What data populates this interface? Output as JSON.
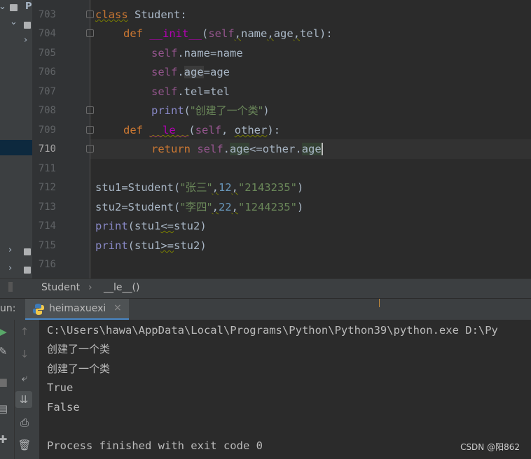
{
  "project_panel": {
    "root_label": "P"
  },
  "editor": {
    "lines": [
      {
        "num": "703"
      },
      {
        "num": "704"
      },
      {
        "num": "705"
      },
      {
        "num": "706"
      },
      {
        "num": "707"
      },
      {
        "num": "708"
      },
      {
        "num": "709"
      },
      {
        "num": "710"
      },
      {
        "num": "711"
      },
      {
        "num": "712"
      },
      {
        "num": "713"
      },
      {
        "num": "714"
      },
      {
        "num": "715"
      },
      {
        "num": "716"
      }
    ],
    "tokens": {
      "class_kw": "class",
      "class_name": " Student:",
      "def1": "def",
      "init": "__init__",
      "paren_open": "(",
      "self1": "self",
      "params1": "name",
      "c1": ",",
      "p_age": "age",
      "c2": ",",
      "p_tel": "tel",
      "close1": "):",
      "self_name": "self",
      "name_assign": ".name=name",
      "self_age": "self",
      "dot_age": ".",
      "age_attr": "age",
      "age_assign": "=age",
      "self_tel": "self",
      "tel_assign": ".tel=tel",
      "print1": "print",
      "print1_open": "(",
      "print1_str": "\"创建了一个类\"",
      "print1_close": ")",
      "def2": "def",
      "le": "__le__",
      "le_open": "(",
      "self2": "self",
      "other_sep": ", ",
      "other": "other",
      "le_close": "):",
      "ret": "return",
      "ret_self": "self",
      "ret_dot": ".",
      "ret_age": "age",
      "ret_op": "<=",
      "ret_other": "other.",
      "ret_age2": "age",
      "stu1_lhs": "stu1=Student(",
      "stu1_s1": "\"张三\"",
      "stu1_c1": ",",
      "stu1_n": "12",
      "stu1_c2": ",",
      "stu1_s2": "\"2143235\"",
      "stu1_close": ")",
      "stu2_lhs": "stu2=Student(",
      "stu2_s1": "\"李四\"",
      "stu2_c1": ",",
      "stu2_n": "22",
      "stu2_c2": ",",
      "stu2_s2": "\"1244235\"",
      "stu2_close": ")",
      "p3": "print",
      "p3_args_a": "(stu1",
      "p3_op": "<=",
      "p3_args_b": "stu2)",
      "p4": "print",
      "p4_args_a": "(stu1",
      "p4_op": ">=",
      "p4_args_b": "stu2)"
    }
  },
  "breadcrumb": {
    "class": "Student",
    "method": "__le__()"
  },
  "run_panel": {
    "label": "un:",
    "tab": "heimaxuexi",
    "close": "×",
    "output": [
      "C:\\Users\\hawa\\AppData\\Local\\Programs\\Python\\Python39\\python.exe D:\\Py",
      "创建了一个类",
      "创建了一个类",
      "True",
      "False",
      "",
      "Process finished with exit code 0"
    ]
  },
  "watermark": "CSDN @阳862",
  "colors": {
    "keyword": "#cc7832",
    "self": "#94558d",
    "string": "#6a8759",
    "number": "#6897bb",
    "magic": "#b200b2",
    "builtin": "#8888c6",
    "background": "#2b2b2b"
  }
}
